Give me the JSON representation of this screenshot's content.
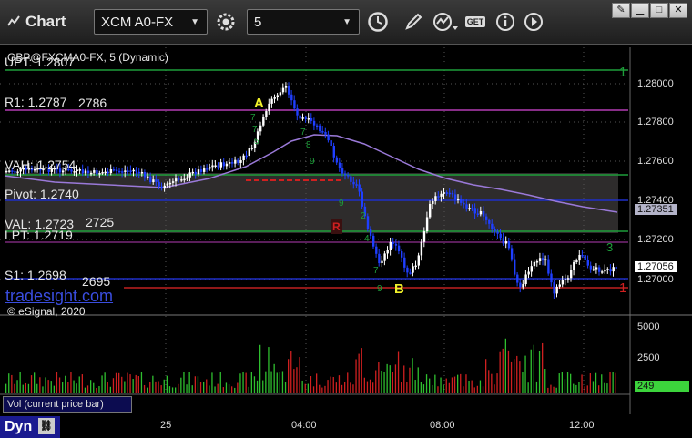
{
  "toolbar": {
    "title": "Chart",
    "symbol": "XCM A0-FX",
    "interval": "5",
    "get_label": "GET"
  },
  "chart": {
    "header": "GBP@FXCMA0-FX, 5 (Dynamic)",
    "watermark": "tradesight.com",
    "copyright": "© eSignal, 2020",
    "price_axis": [
      "1.28000",
      "1.27800",
      "1.27600",
      "1.27400",
      "1.27200",
      "1.27000"
    ],
    "last_price_tag": "1.27351",
    "current_price_tag": "1.27056",
    "levels": {
      "upt": "UPT: 1.2807",
      "r1": "R1: 1.2787",
      "r1_overlap": "2786",
      "vah": "VAH: 1.2754",
      "pivot": "Pivot: 1.2740",
      "val": "VAL: 1.2723",
      "val_overlap": "2725",
      "lpt": "LPT: 1.2719",
      "s1": "S1: 1.2698",
      "s1_overlap": "2695"
    },
    "markers": {
      "a": "A",
      "b": "B",
      "r": "R",
      "one_top": "1",
      "one_bottom": "1",
      "three": "3"
    },
    "volume_axis": [
      "5000",
      "2500"
    ],
    "volume_tag": "249",
    "volume_label": "Vol (current price bar)",
    "time_axis": [
      "25",
      "04:00",
      "08:00",
      "12:00"
    ],
    "bottom_label": "Dyn",
    "colors": {
      "up": "#ffffff",
      "down": "#1f3fff",
      "vol_up": "#2fbf2f",
      "vol_down": "#cf2020",
      "upt_line": "#1e9e3a",
      "r1_line": "#b43cb4",
      "pivot_line": "#1f2fc8",
      "vwap": "#9a79d8",
      "s1_line": "#c02020"
    }
  }
}
